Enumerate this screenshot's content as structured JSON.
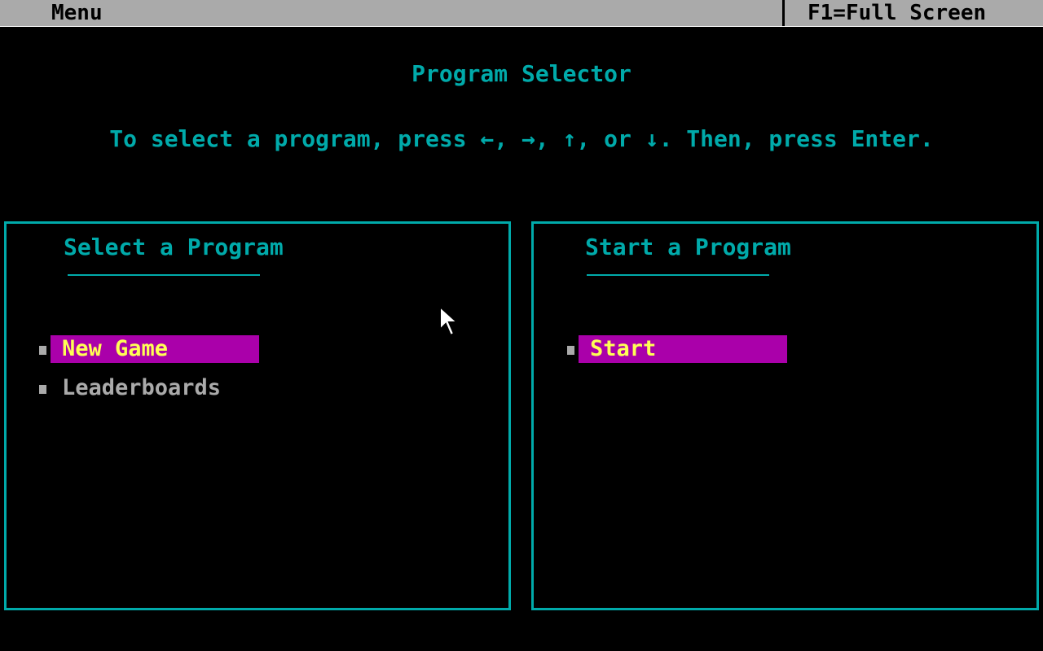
{
  "menubar": {
    "menu_label": "Menu",
    "fkey_label": "F1=Full Screen"
  },
  "heading": "Program Selector",
  "instructions": "To select a program, press ←, →, ↑, or ↓. Then, press Enter.",
  "select_panel": {
    "title": "Select a Program",
    "items": [
      {
        "label": "New Game",
        "selected": true
      },
      {
        "label": "Leaderboards",
        "selected": false
      }
    ]
  },
  "start_panel": {
    "title": "Start a Program",
    "items": [
      {
        "label": "Start",
        "selected": true
      }
    ]
  },
  "colors": {
    "background": "#000000",
    "accent": "#00aaaa",
    "menubar": "#aaaaaa",
    "highlight_bg": "#aa00aa",
    "highlight_text": "#ffff55",
    "normal_text": "#aaaaaa"
  },
  "icons": {
    "pointer": "mouse-pointer-icon",
    "bullet": "bullet-icon"
  }
}
